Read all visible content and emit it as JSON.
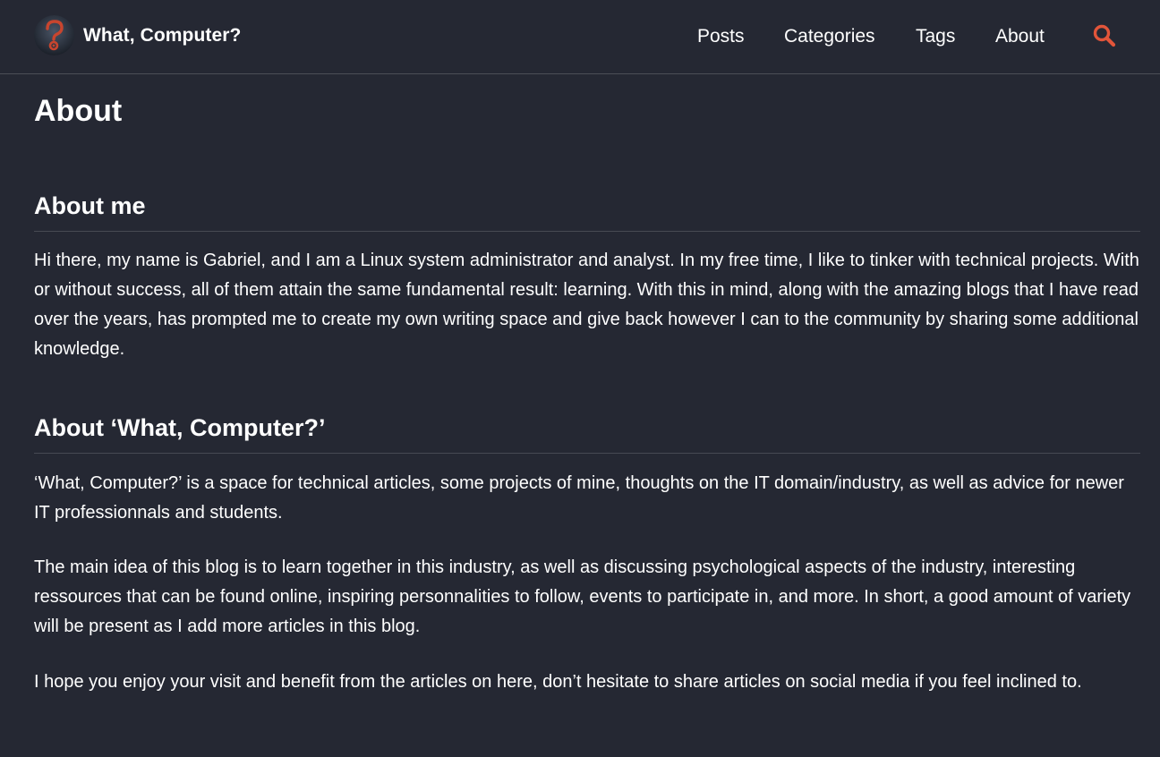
{
  "header": {
    "site_title": "What, Computer?",
    "logo_icon": "question-mark-logo-icon",
    "nav": [
      {
        "label": "Posts"
      },
      {
        "label": "Categories"
      },
      {
        "label": "Tags"
      },
      {
        "label": "About"
      }
    ],
    "search_icon": "search-icon",
    "accent_color": "#e2553a"
  },
  "page": {
    "title": "About",
    "sections": [
      {
        "heading": "About me",
        "paragraphs": [
          "Hi there, my name is Gabriel, and I am a Linux system administrator and analyst. In my free time, I like to tinker with technical projects. With or without success, all of them attain the same fundamental result: learning. With this in mind, along with the amazing blogs that I have read over the years, has prompted me to create my own writing space and give back however I can to the community by sharing some additional knowledge."
        ]
      },
      {
        "heading": "About ‘What, Computer?’",
        "paragraphs": [
          "‘What, Computer?’ is a space for technical articles, some projects of mine, thoughts on the IT domain/industry, as well as advice for newer IT professionnals and students.",
          "The main idea of this blog is to learn together in this industry, as well as discussing psychological aspects of the industry, interesting ressources that can be found online, inspiring personnalities to follow, events to participate in, and more. In short, a good amount of variety will be present as I add more articles in this blog.",
          "I hope you enjoy your visit and benefit from the articles on here, don’t hesitate to share articles on social media if you feel inclined to."
        ]
      }
    ]
  },
  "colors": {
    "background": "#252833",
    "text": "#ffffff",
    "divider": "#474a53"
  }
}
